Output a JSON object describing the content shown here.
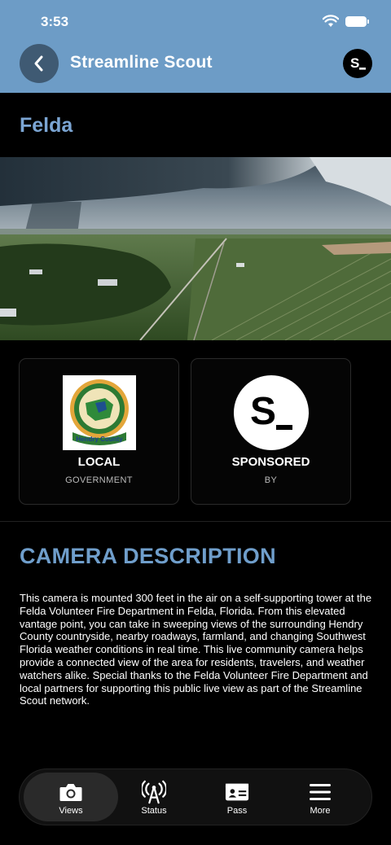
{
  "status_bar": {
    "time": "3:53"
  },
  "header": {
    "app_title": "Streamline Scout",
    "brand_glyph": "S_"
  },
  "location": {
    "name": "Felda"
  },
  "cards": [
    {
      "title": "LOCAL",
      "subtitle": "GOVERNMENT",
      "logo": "hendry-county-seal",
      "seal_text": "Hendry County"
    },
    {
      "title": "SPONSORED",
      "subtitle": "BY",
      "logo": "streamline-s-logo",
      "logo_text": "S_"
    }
  ],
  "description": {
    "heading": "CAMERA DESCRIPTION",
    "body": "This camera is mounted 300 feet in the air on a self-supporting tower at the Felda Volunteer Fire Department in Felda, Florida. From this elevated vantage point, you can take in sweeping views of the surrounding Hendry County countryside, nearby roadways, farmland, and changing Southwest Florida weather conditions in real time. This live community camera helps provide a connected view of the area for residents, travelers, and weather watchers alike. Special thanks to the Felda Volunteer Fire Department and local partners for supporting this public live view as part of the Streamline Scout network."
  },
  "tabs": [
    {
      "label": "Views",
      "icon": "camera-icon",
      "active": true
    },
    {
      "label": "Status",
      "icon": "broadcast-tower-icon",
      "active": false
    },
    {
      "label": "Pass",
      "icon": "id-card-icon",
      "active": false
    },
    {
      "label": "More",
      "icon": "hamburger-menu-icon",
      "active": false
    }
  ],
  "colors": {
    "header_bg": "#6d9cc6",
    "accent_text": "#7ba5d3",
    "background": "#000000"
  }
}
